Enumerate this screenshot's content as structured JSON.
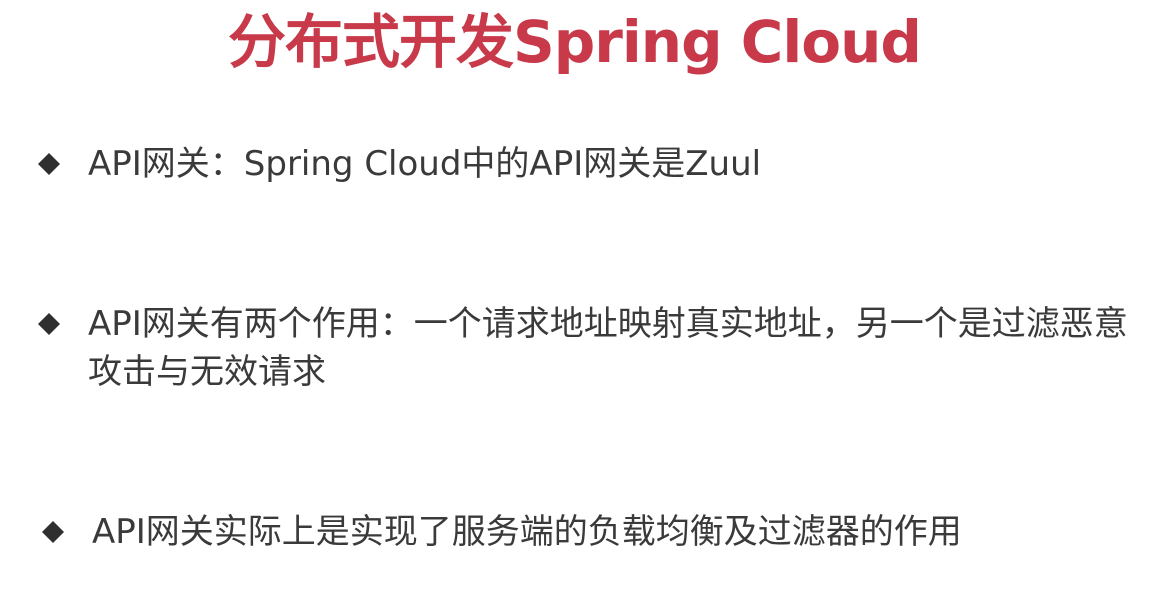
{
  "slide": {
    "title": "分布式开发Spring Cloud",
    "title_color": "#c8394a",
    "text_color": "#3a3a3a",
    "bullet_icon": "diamond-bullet-icon",
    "bullets": [
      {
        "text": "API网关：Spring Cloud中的API网关是Zuul"
      },
      {
        "text": "API网关有两个作用：一个请求地址映射真实地址，另一个是过滤恶意攻击与无效请求"
      },
      {
        "text": "API网关实际上是实现了服务端的负载均衡及过滤器的作用"
      }
    ]
  }
}
